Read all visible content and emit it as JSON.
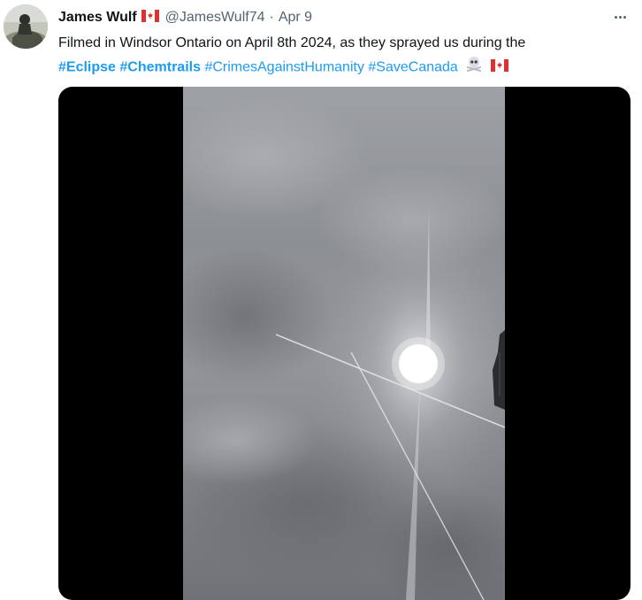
{
  "tweet": {
    "author_name": "James Wulf",
    "author_handle": "@JamesWulf74",
    "separator": "·",
    "date": "Apr 9",
    "text_plain": "Filmed in Windsor Ontario on April 8th 2024, as they sprayed us during the",
    "hashtags": [
      "#Eclipse",
      "#Chemtrails",
      "#CrimesAgainstHumanity",
      "#SaveCanada"
    ],
    "trailing_emoji": [
      "skull-and-crossbones-icon",
      "canada-flag-icon"
    ]
  },
  "colors": {
    "link": "#1d9bf0",
    "text": "#0f1419",
    "secondary": "#536471",
    "media_background": "#000000"
  },
  "icons": {
    "author_flag": "canada-flag-icon",
    "more": "more-options-icon"
  }
}
